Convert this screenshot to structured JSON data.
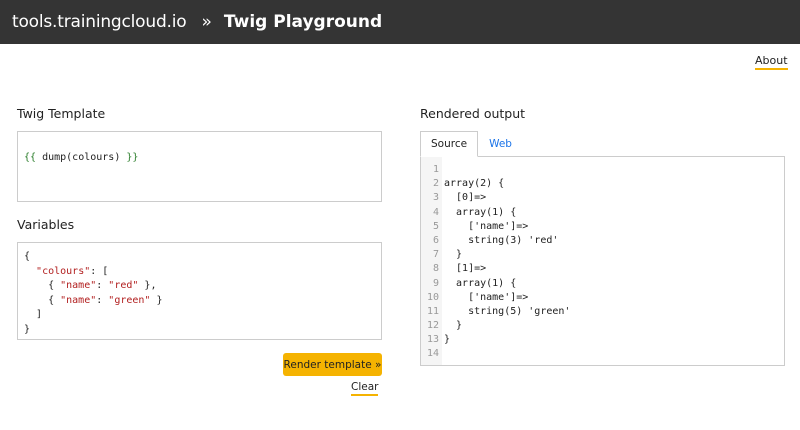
{
  "header": {
    "site": "tools.trainingcloud.io",
    "separator": "»",
    "title": "Twig Playground"
  },
  "nav": {
    "about": "About"
  },
  "template_panel": {
    "label": "Twig Template",
    "code": {
      "open": "{{",
      "body": " dump(colours) ",
      "close": "}}"
    }
  },
  "variables_panel": {
    "label": "Variables",
    "lines": {
      "l1": "{",
      "l2_indent": "  ",
      "l2_key": "\"colours\"",
      "l2_rest": ": [",
      "l3_pre": "    { ",
      "l3_key": "\"name\"",
      "l3_colon": ": ",
      "l3_val": "\"red\"",
      "l3_post": " },",
      "l4_pre": "    { ",
      "l4_key": "\"name\"",
      "l4_colon": ": ",
      "l4_val": "\"green\"",
      "l4_post": " }",
      "l5": "  ]",
      "l6": "}"
    }
  },
  "actions": {
    "render": "Render template »",
    "clear": "Clear"
  },
  "output_panel": {
    "label": "Rendered output",
    "tabs": [
      {
        "label": "Source",
        "active": true
      },
      {
        "label": "Web",
        "active": false
      }
    ],
    "line_numbers": [
      "1",
      "2",
      "3",
      "4",
      "5",
      "6",
      "7",
      "8",
      "9",
      "10",
      "11",
      "12",
      "13",
      "14"
    ],
    "lines": [
      "",
      "array(2) {",
      "  [0]=>",
      "  array(1) {",
      "    ['name']=>",
      "    string(3) 'red'",
      "  }",
      "  [1]=>",
      "  array(1) {",
      "    ['name']=>",
      "    string(5) 'green'",
      "  }",
      "}",
      ""
    ]
  },
  "colors": {
    "topbar": "#343434",
    "accent": "#f5b301",
    "link": "#1a73e8",
    "template_brace": "#2a7d2a",
    "json_string": "#b21f1f"
  }
}
